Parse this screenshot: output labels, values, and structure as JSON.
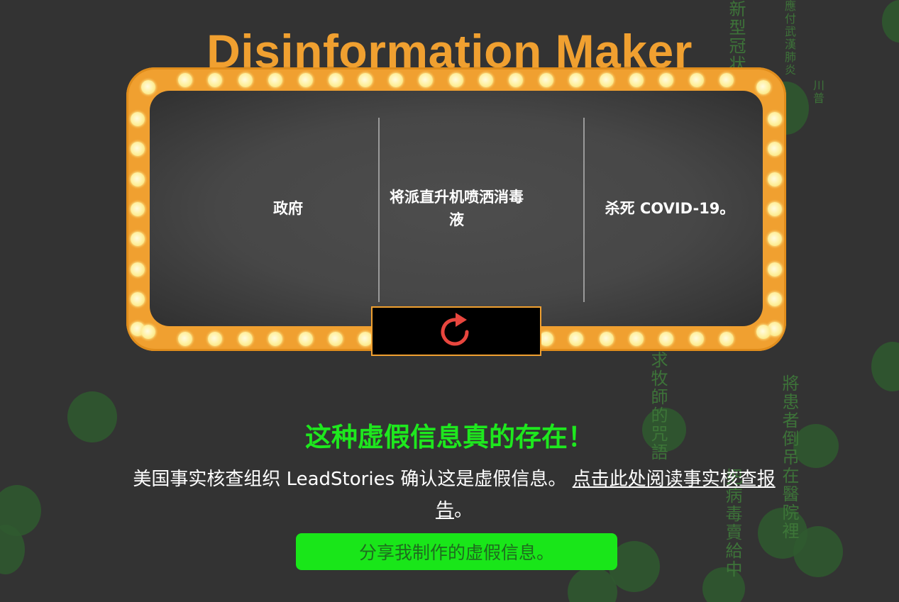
{
  "app": {
    "title": "Disinformation Maker"
  },
  "marquee": {
    "slots": [
      "政府",
      "将派直升机喷洒消毒液",
      "杀死 COVID-19。"
    ],
    "reload_icon": "refresh-icon"
  },
  "result": {
    "headline": "这种虚假信息真的存在！",
    "body_prefix": "美国事实核查组织 LeadStories 确认这是虚假信息。",
    "link_text": "点击此处阅读事实核查报告",
    "body_suffix": "。"
  },
  "share_button": {
    "label": "分享我制作的虚假信息。"
  },
  "background": {
    "floating_texts": [
      "新型冠状",
      "應付武漢肺炎",
      "川普",
      "求牧師的咒語",
      "將患者倒吊在醫院裡",
      "把病毒賣給中"
    ]
  },
  "colors": {
    "page_bg": "#333333",
    "accent_orange": "#f0a030",
    "bulb": "#fff2a8",
    "headline_green": "#1ee81e",
    "button_green": "#19e619",
    "reload_red": "#e8463e"
  }
}
